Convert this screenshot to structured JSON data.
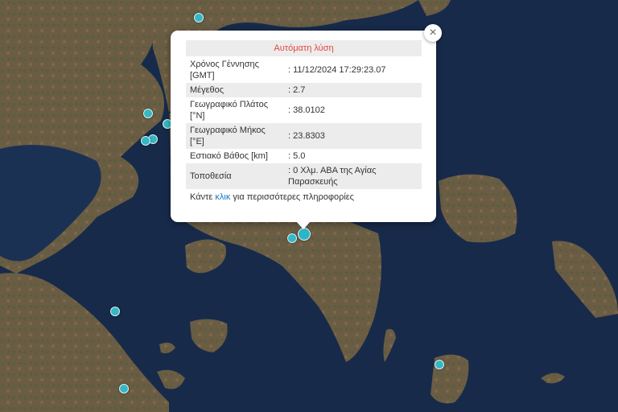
{
  "popup": {
    "title": "Αυτόματη λύση",
    "rows": [
      {
        "label": "Χρόνος Γέννησης [GMT]",
        "value": ": 11/12/2024 17:29:23.07"
      },
      {
        "label": "Μέγεθος",
        "value": ": 2.7"
      },
      {
        "label": "Γεωγραφικό Πλάτος [°N]",
        "value": ": 38.0102"
      },
      {
        "label": "Γεωγραφικό Μήκος [°E]",
        "value": ": 23.8303"
      },
      {
        "label": "Εστιακό Βάθος [km]",
        "value": ": 5.0"
      },
      {
        "label": "Τοποθεσία",
        "value": ": 0 Χλμ. ΑΒΑ της Αγίας Παρασκευής"
      }
    ],
    "more_prefix": "Κάντε ",
    "more_link": "κλικ",
    "more_suffix": " για περισσότερες πληροφορίες",
    "close_glyph": "×"
  },
  "colors": {
    "sea": "#172a4a",
    "land": "#6e5e45",
    "vegetation": "#4a5a35",
    "marker": "#35b7c4",
    "title": "#e4463b",
    "link": "#1a73c8"
  }
}
